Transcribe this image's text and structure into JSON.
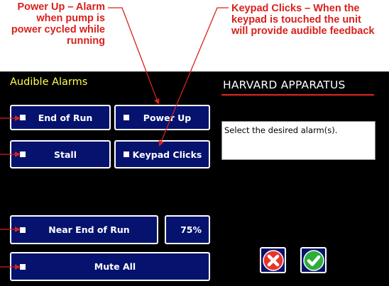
{
  "callouts": {
    "power_up": "Power Up – Alarm\nwhen pump is\npower cycled while\nrunning",
    "keypad_clicks": "Keypad Clicks – When the\nkeypad is touched the unit\nwill provide audible feedback"
  },
  "screen": {
    "title": "Audible Alarms",
    "brand": "HARVARD APPARATUS",
    "info_text": "Select the desired alarm(s)."
  },
  "buttons": {
    "end_of_run": "End of Run",
    "power_up": "Power Up",
    "stall": "Stall",
    "keypad_clicks": "Keypad Clicks",
    "near_end_of_run": "Near End of Run",
    "near_end_percent": "75%",
    "mute_all": "Mute All"
  },
  "icons": {
    "cancel": "cancel-icon",
    "confirm": "confirm-icon"
  },
  "colors": {
    "callout_red": "#d8211c",
    "button_blue": "#05126e",
    "title_yellow": "#ffff4a",
    "brand_underline": "#e4261c"
  }
}
